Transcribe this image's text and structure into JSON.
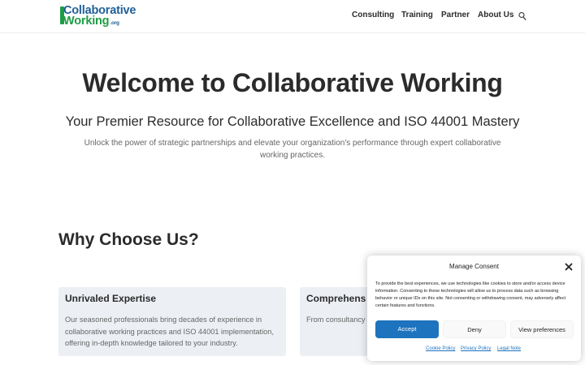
{
  "header": {
    "logo": {
      "line1": "Collaborative",
      "line2": "Working",
      "suffix": ".org"
    },
    "nav": [
      "Consulting",
      "Training",
      "Partner",
      "About Us"
    ]
  },
  "hero": {
    "title": "Welcome to Collaborative Working",
    "subtitle": "Your Premier Resource for Collaborative Excellence and ISO 44001 Mastery",
    "description": "Unlock the power of strategic partnerships and elevate your organization's performance through expert collaborative working practices."
  },
  "why": {
    "title": "Why Choose Us?",
    "cards": [
      {
        "title": "Unrivaled Expertise",
        "text": "Our seasoned professionals bring decades of experience in collaborative working practices and ISO 44001 implementation, offering in-depth knowledge tailored to your industry."
      },
      {
        "title": "Comprehens",
        "text": "From consultancy t end support for yo"
      }
    ]
  },
  "consent": {
    "title": "Manage Consent",
    "text": "To provide the best experiences, we use technologies like cookies to store and/or access device information. Consenting to these technologies will allow us to process data such as browsing behavior or unique IDs on this site. Not consenting or withdrawing consent, may adversely affect certain features and functions.",
    "accept": "Accept",
    "deny": "Deny",
    "preferences": "View preferences",
    "links": [
      "Cookie Policy",
      "Privacy Policy",
      "Legal Note"
    ]
  },
  "colors": {
    "brand_blue": "#1f5f99",
    "brand_green": "#1e9c46",
    "accept_blue": "#1e73be",
    "card_bg": "#eceff4"
  },
  "icons": [
    "search-icon",
    "close-icon"
  ]
}
